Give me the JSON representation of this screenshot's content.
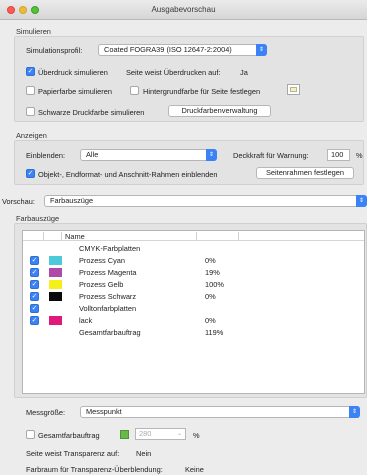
{
  "window": {
    "title": "Ausgabevorschau"
  },
  "simulieren": {
    "group_label": "Simulieren",
    "profile_label": "Simulationsprofil:",
    "profile_value": "Coated FOGRA39 (ISO 12647-2:2004)",
    "overprint_label": "Überdruck simulieren",
    "overprint_checked": true,
    "overprint_info_label": "Seite weist Überdrucken auf:",
    "overprint_info_value": "Ja",
    "paper_color_label": "Papierfarbe simulieren",
    "paper_color_checked": false,
    "bg_color_label": "Hintergrundfarbe für Seite festlegen",
    "bg_color_checked": false,
    "black_ink_label": "Schwarze Druckfarbe simulieren",
    "black_ink_checked": false,
    "ink_manager_button": "Druckfarbenverwaltung"
  },
  "anzeigen": {
    "group_label": "Anzeigen",
    "show_label": "Einblenden:",
    "show_value": "Alle",
    "warning_opacity_label": "Deckkraft für Warnung:",
    "warning_opacity_value": "100",
    "warning_opacity_unit": "%",
    "frames_label": "Objekt-, Endformat- und Anschnitt-Rahmen einblenden",
    "frames_checked": true,
    "page_frames_button": "Seitenrahmen festlegen"
  },
  "vorschau": {
    "label": "Vorschau:",
    "value": "Farbauszüge"
  },
  "farbauszuege": {
    "group_label": "Farbauszüge",
    "column_name": "Name",
    "rows": [
      {
        "name": "CMYK-Farbplatten",
        "pct": "",
        "eye": false,
        "swatch": ""
      },
      {
        "name": "Prozess Cyan",
        "pct": "0%",
        "eye": true,
        "swatch": "#4ec9d9"
      },
      {
        "name": "Prozess Magenta",
        "pct": "19%",
        "eye": true,
        "swatch": "#b04aa8"
      },
      {
        "name": "Prozess Gelb",
        "pct": "100%",
        "eye": true,
        "swatch": "#f5ef1a"
      },
      {
        "name": "Prozess Schwarz",
        "pct": "0%",
        "eye": true,
        "swatch": "#0a0a0a"
      },
      {
        "name": "Volltonfarbplatten",
        "pct": "",
        "eye": true,
        "swatch": ""
      },
      {
        "name": "lack",
        "pct": "0%",
        "eye": true,
        "swatch": "#e0187c"
      },
      {
        "name": "Gesamtfarbauftrag",
        "pct": "119%",
        "eye": false,
        "swatch": ""
      }
    ]
  },
  "messgroesse": {
    "label": "Messgröße:",
    "value": "Messpunkt"
  },
  "gesamt": {
    "label": "Gesamtfarbauftrag",
    "checked": false,
    "value": "280",
    "unit": "%",
    "swatch_color": "#67b94a"
  },
  "transparency": {
    "has_transparency_label": "Seite weist Transparenz auf:",
    "has_transparency_value": "Nein",
    "blend_space_label": "Farbraum für Transparenz-Überblendung:",
    "blend_space_value": "Keine"
  }
}
